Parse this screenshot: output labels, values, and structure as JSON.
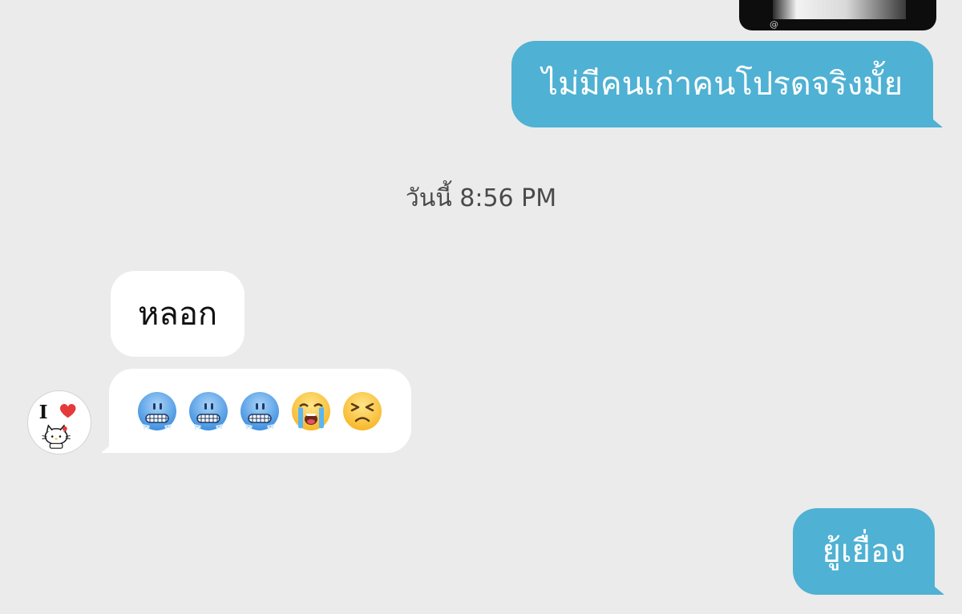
{
  "chat": {
    "prior_media": {
      "tag": "@"
    },
    "messages": [
      {
        "direction": "outgoing",
        "text": "ไม่มีคนเก่าคนโปรดจริงมั้ย"
      },
      {
        "direction": "incoming",
        "text": "หลอก"
      },
      {
        "direction": "incoming",
        "emojis": [
          "cold-face",
          "cold-face",
          "cold-face",
          "loudly-crying-face",
          "persevering-face"
        ]
      },
      {
        "direction": "outgoing",
        "text": "ยู้เยื่อง"
      }
    ],
    "timestamp": "วันนี้ 8:56 PM",
    "avatar": {
      "icon": "i-love-hello-kitty-avatar",
      "letter": "I"
    }
  },
  "colors": {
    "background": "#ebebeb",
    "outgoing_bubble": "#4fb1d3",
    "incoming_bubble": "#ffffff",
    "outgoing_text": "#ffffff",
    "incoming_text": "#111111",
    "timestamp_text": "#4a4a4a"
  }
}
